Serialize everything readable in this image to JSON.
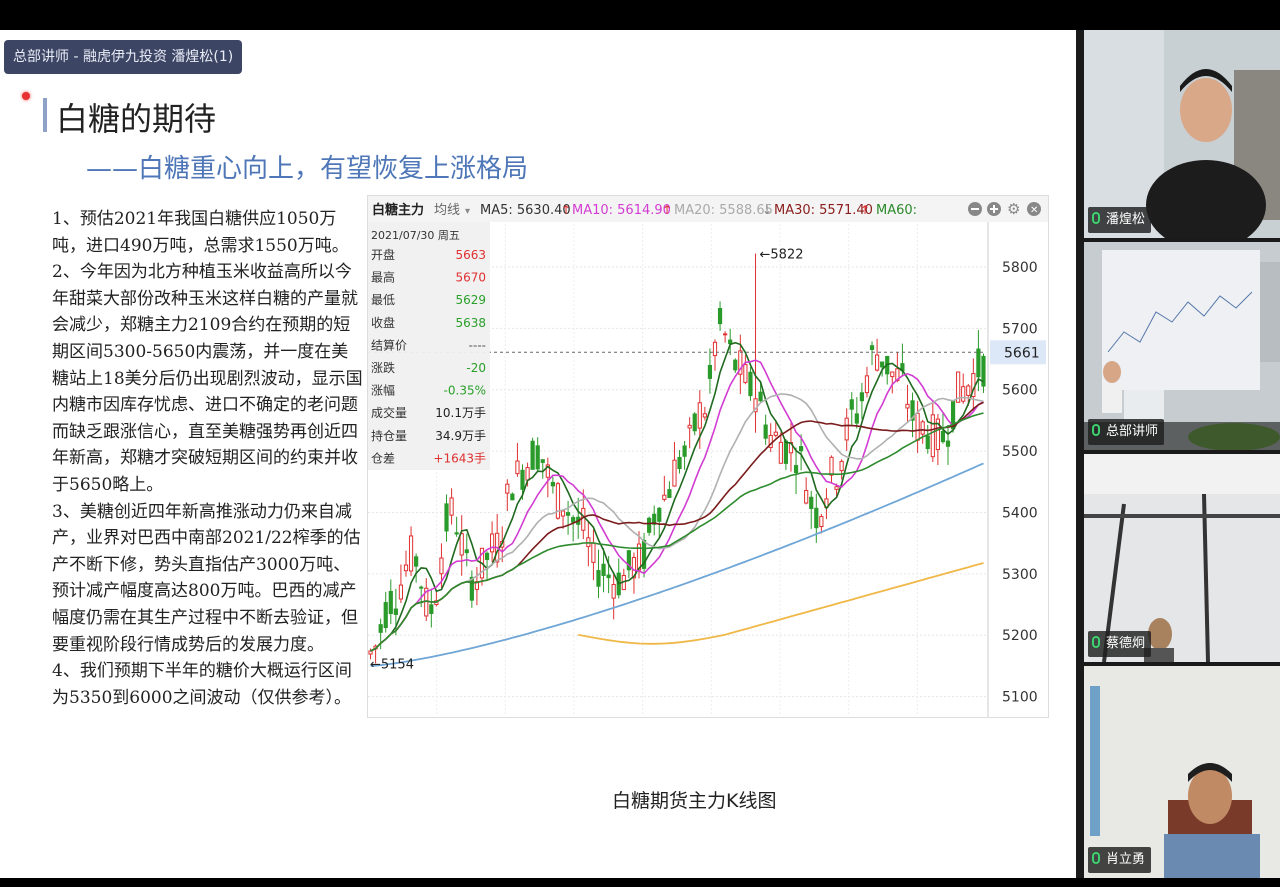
{
  "slide": {
    "presenter_tag": "总部讲师 - 融虎伊九投资 潘煌松(1)",
    "title": "白糖的期待",
    "subtitle": "——白糖重心向上，有望恢复上涨格局",
    "paragraphs": [
      "1、预估2021年我国白糖供应1050万吨，进口490万吨，总需求1550万吨。",
      "2、今年因为北方种植玉米收益高所以今年甜菜大部份改种玉米这样白糖的产量就会减少，郑糖主力2109合约在预期的短期区间5300-5650内震荡，并一度在美糖站上18美分后仍出现剧烈波动，显示国内糖市因库存忧虑、进口不确定的老问题而缺乏跟涨信心，直至美糖强势再创近四年新高，郑糖才突破短期区间的约束并收于5650略上。",
      "3、美糖创近四年新高推涨动力仍来自减产，业界对巴西中南部2021/22榨季的估产不断下修，势头直指估产3000万吨、预计减产幅度高达800万吨。巴西的减产幅度仍需在其生产过程中不断去验证，但要重视阶段行情成势后的发展力度。",
      "4、我们预期下半年的糖价大概运行区间为5350到6000之间波动（仅供参考）。"
    ],
    "chart_caption": "白糖期货主力K线图"
  },
  "chart_header": {
    "name": "白糖主力",
    "indicator": "均线",
    "ma5": "MA5: 5630.40",
    "ma10": "MA10: 5614.90",
    "ma20": "MA20: 5588.65",
    "ma30": "MA30: 5571.40",
    "ma60": "MA60:"
  },
  "info_panel": {
    "date": "2021/07/30 周五",
    "rows": [
      {
        "label": "开盘",
        "value": "5663",
        "color": "#e03030"
      },
      {
        "label": "最高",
        "value": "5670",
        "color": "#e03030"
      },
      {
        "label": "最低",
        "value": "5629",
        "color": "#2aa02a"
      },
      {
        "label": "收盘",
        "value": "5638",
        "color": "#2aa02a"
      },
      {
        "label": "结算价",
        "value": "----",
        "color": "#555555"
      },
      {
        "label": "涨跌",
        "value": "-20",
        "color": "#2aa02a"
      },
      {
        "label": "涨幅",
        "value": "-0.35%",
        "color": "#2aa02a"
      },
      {
        "label": "成交量",
        "value": "10.1万手",
        "color": "#222222"
      },
      {
        "label": "持仓量",
        "value": "34.9万手",
        "color": "#222222"
      },
      {
        "label": "仓差",
        "value": "+1643手",
        "color": "#e03030"
      }
    ]
  },
  "chart_data": {
    "type": "candlestick",
    "title": "白糖主力",
    "y_ticks": [
      5800,
      5700,
      5600,
      5500,
      5400,
      5300,
      5200,
      5100
    ],
    "ylim": [
      5070,
      5870
    ],
    "current_price": "5661",
    "annotations": [
      {
        "label": "5822",
        "value": 5822
      },
      {
        "label": "5154",
        "value": 5154
      }
    ],
    "moving_averages": [
      "MA5",
      "MA10",
      "MA20",
      "MA30",
      "MA60"
    ],
    "series_colors": {
      "up": "#e03030",
      "down": "#2a9a2a",
      "ma5": "#1f6a1f",
      "ma10": "#d23cd2",
      "ma20": "#b0b0b0",
      "ma30": "#7a1c1c",
      "ma60": "#2e8b2e",
      "ma120": "#6fa6d6",
      "ma250": "#f0b848"
    }
  },
  "participants": [
    {
      "name": "潘煌松"
    },
    {
      "name": "总部讲师"
    },
    {
      "name": "蔡德炯"
    },
    {
      "name": "肖立勇"
    }
  ]
}
